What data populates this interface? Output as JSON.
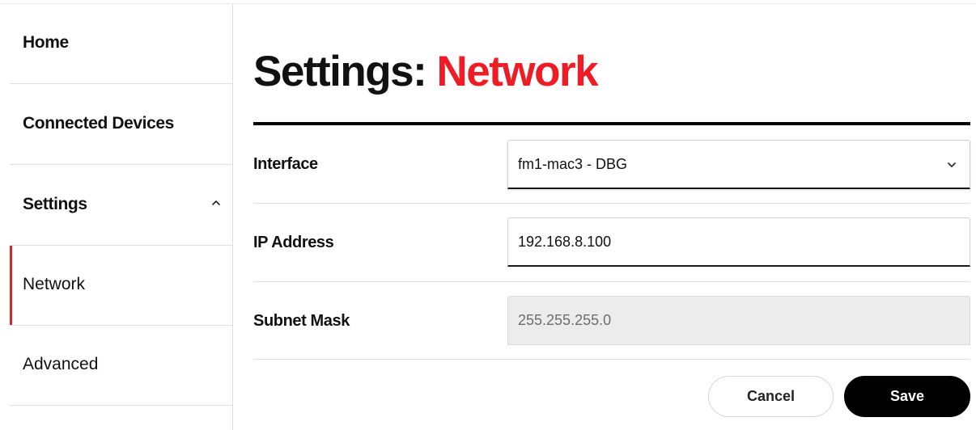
{
  "sidebar": {
    "items": [
      {
        "label": "Home"
      },
      {
        "label": "Connected Devices"
      },
      {
        "label": "Settings"
      },
      {
        "label": "Network"
      },
      {
        "label": "Advanced"
      }
    ]
  },
  "page": {
    "title_prefix": "Settings:",
    "title_accent": "Network"
  },
  "form": {
    "interface": {
      "label": "Interface",
      "value": "fm1-mac3 - DBG"
    },
    "ip_address": {
      "label": "IP Address",
      "value": "192.168.8.100"
    },
    "subnet_mask": {
      "label": "Subnet Mask",
      "value": "255.255.255.0"
    }
  },
  "actions": {
    "cancel_label": "Cancel",
    "save_label": "Save"
  },
  "icons": {
    "settings_expand": "chevron-up-icon",
    "interface_dropdown": "chevron-down-icon"
  },
  "colors": {
    "accent": "#ee1c24",
    "active_indicator": "#d7282f",
    "primary_button": "#000000"
  }
}
